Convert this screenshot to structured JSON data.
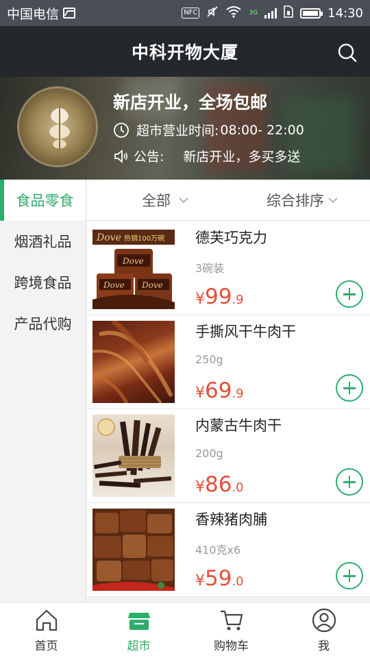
{
  "status_bar": {
    "carrier": "中国电信",
    "nfc": "NFC",
    "network": "3G",
    "time": "14:30"
  },
  "header": {
    "title": "中科开物大厦",
    "search_icon": "search-icon"
  },
  "store": {
    "name": "新店开业，全场包邮",
    "hours_label": "超市营业时间:",
    "hours_value": "08:00- 22:00",
    "notice_label": "公告:",
    "notice_text": "新店开业，多买多送"
  },
  "categories": [
    {
      "label": "食品零食",
      "active": true
    },
    {
      "label": "烟酒礼品",
      "active": false
    },
    {
      "label": "跨境食品",
      "active": false
    },
    {
      "label": "产品代购",
      "active": false
    }
  ],
  "sort": {
    "filter_label": "全部",
    "order_label": "综合排序"
  },
  "products": [
    {
      "name": "德芙巧克力",
      "spec": "3碗装",
      "currency": "¥",
      "price_int": "99",
      "price_dec": ".9",
      "image_text": "Dove",
      "image_banner": "热销100万碗"
    },
    {
      "name": "手撕风干牛肉干",
      "spec": "250g",
      "currency": "¥",
      "price_int": "69",
      "price_dec": ".9"
    },
    {
      "name": "内蒙古牛肉干",
      "spec": "200g",
      "currency": "¥",
      "price_int": "86",
      "price_dec": ".0"
    },
    {
      "name": "香辣猪肉脯",
      "spec": "410克x6",
      "currency": "¥",
      "price_int": "59",
      "price_dec": ".0"
    }
  ],
  "tabs": [
    {
      "label": "首页",
      "icon": "home-icon",
      "active": false
    },
    {
      "label": "超市",
      "icon": "store-icon",
      "active": true
    },
    {
      "label": "购物车",
      "icon": "cart-icon",
      "active": false
    },
    {
      "label": "我",
      "icon": "user-icon",
      "active": false
    }
  ],
  "colors": {
    "accent": "#2dad6b",
    "price": "#e2503a",
    "header_bg": "#24272c",
    "status_bg": "#4a4f57"
  }
}
